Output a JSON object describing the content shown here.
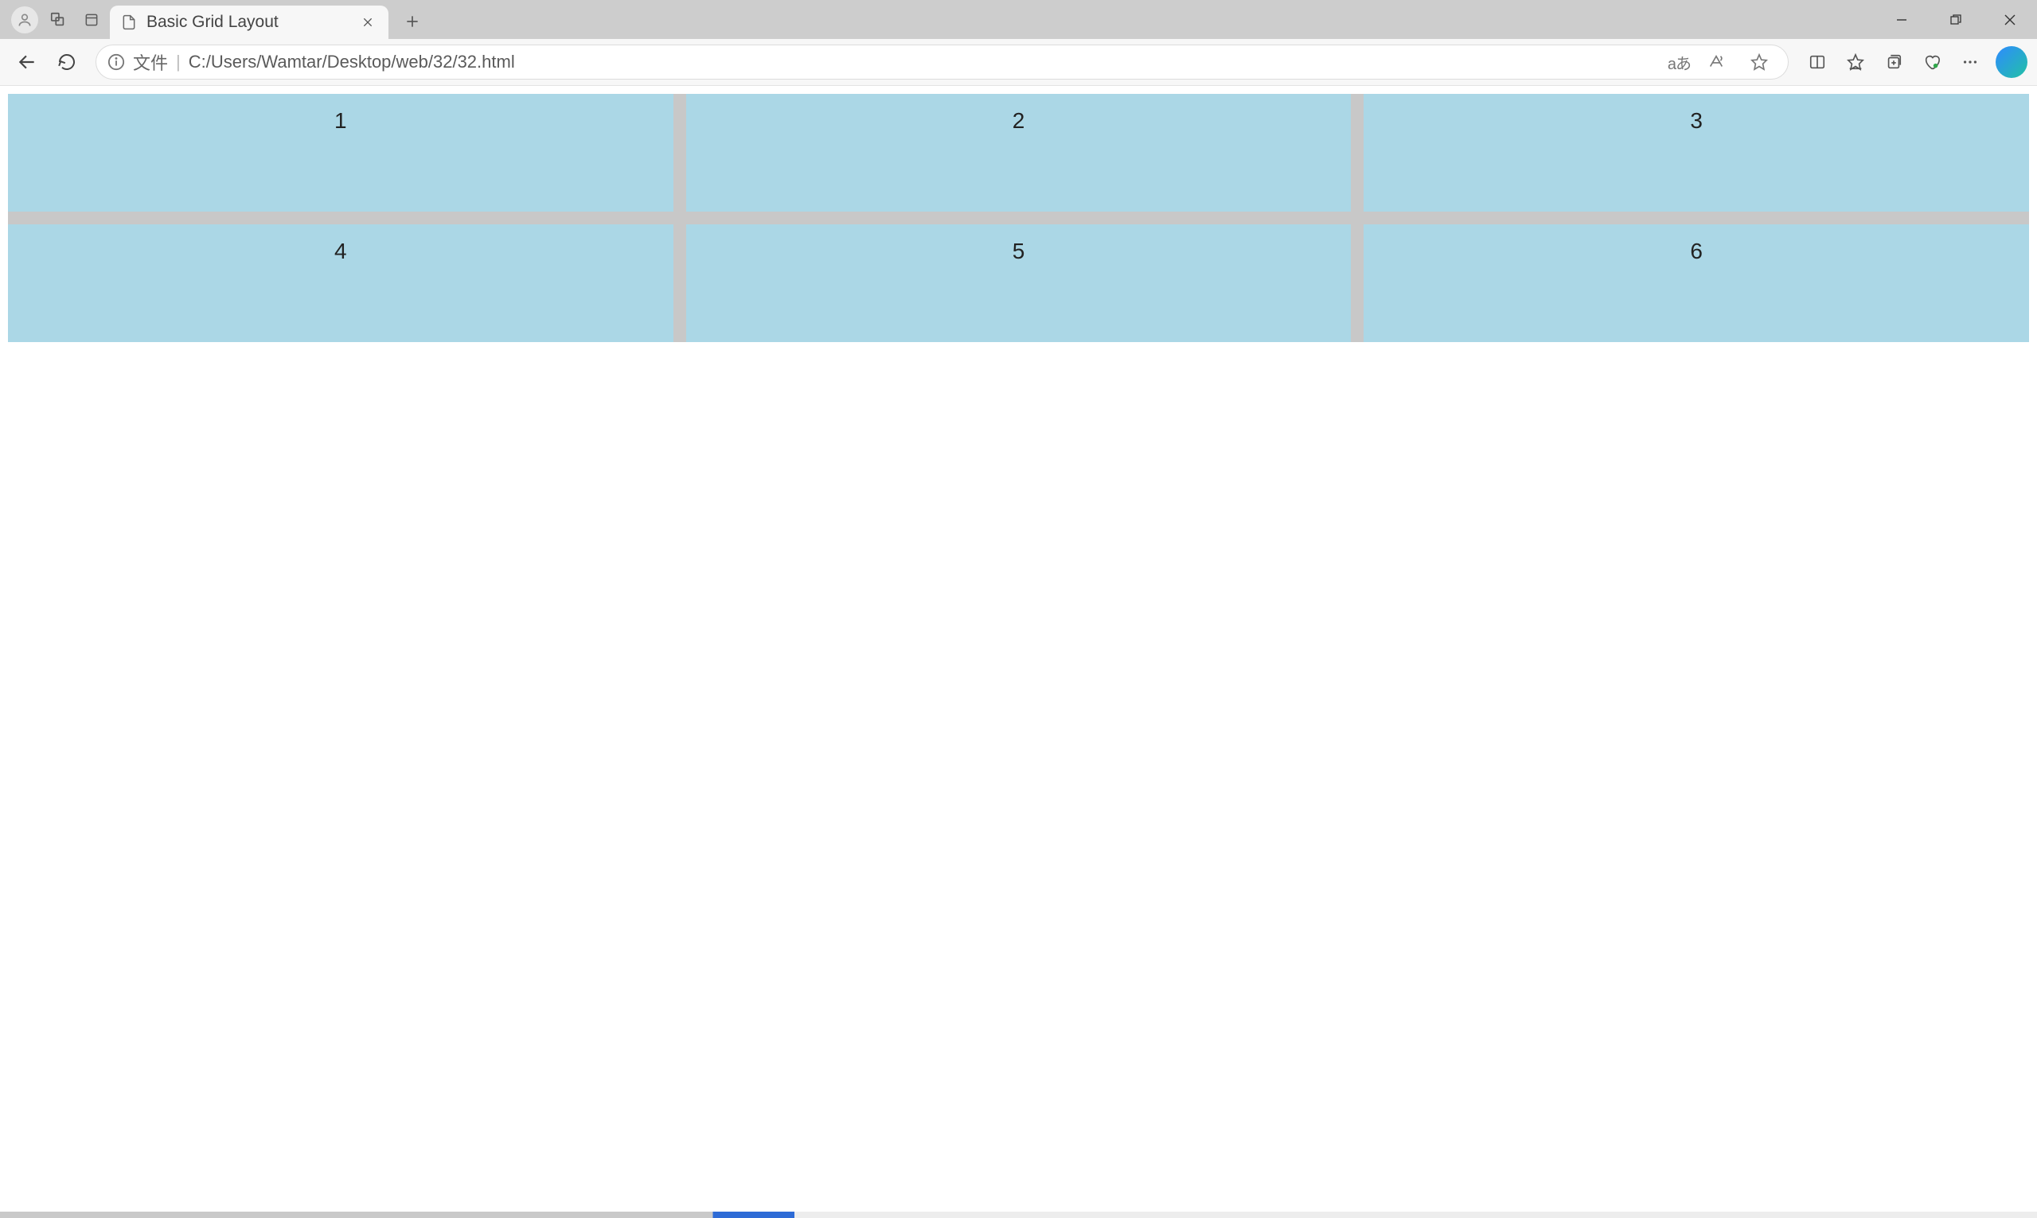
{
  "browser": {
    "tab": {
      "title": "Basic Grid Layout"
    },
    "address": {
      "file_label": "文件",
      "separator": "|",
      "url": "C:/Users/Wamtar/Desktop/web/32/32.html"
    },
    "toolbar": {
      "translate_label": "aあ"
    }
  },
  "page": {
    "grid": {
      "cells": [
        "1",
        "2",
        "3",
        "4",
        "5",
        "6"
      ]
    },
    "colors": {
      "cell_bg": "#abd7e6",
      "gap_bg": "#c8c8c8"
    }
  }
}
